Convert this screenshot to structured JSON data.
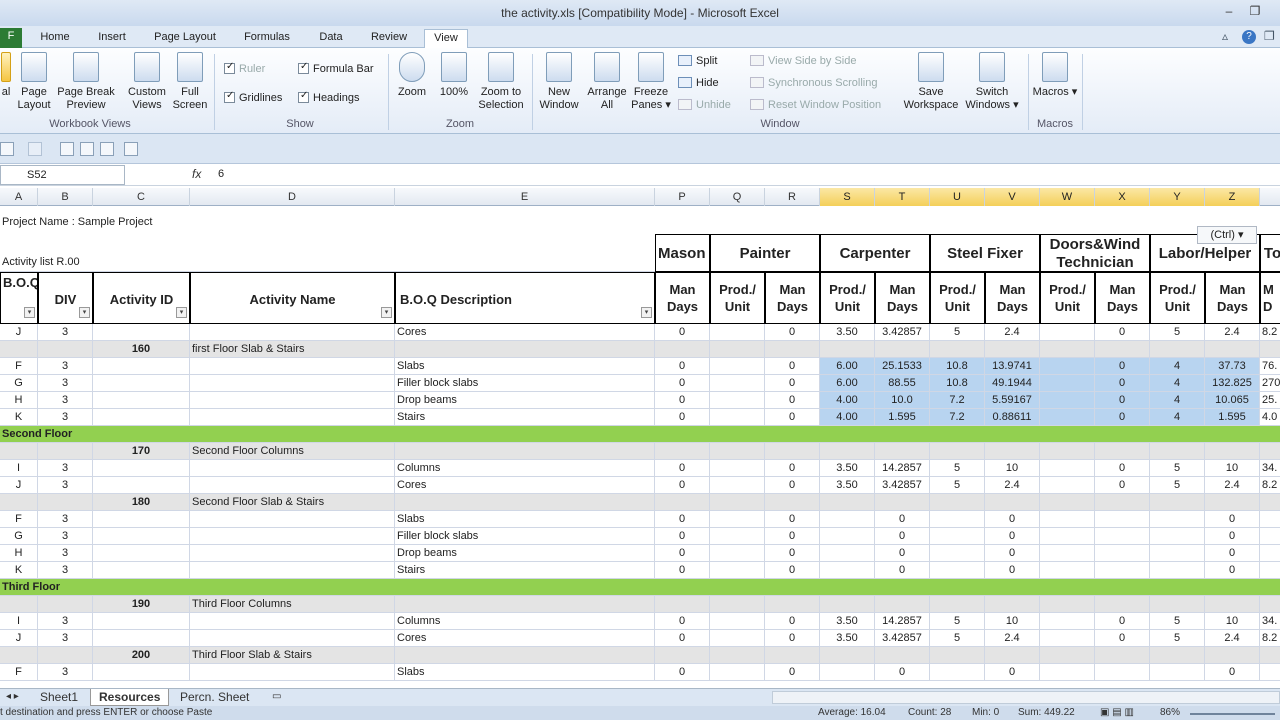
{
  "window": {
    "title": "the activity.xls  [Compatibility Mode]  -  Microsoft Excel",
    "minimize": "–",
    "maximize": "❐"
  },
  "ribbon_tabs": [
    "Home",
    "Insert",
    "Page Layout",
    "Formulas",
    "Data",
    "Review",
    "View"
  ],
  "file_tab": "F",
  "ribbon_right": {
    "minimize_ribbon": "▵",
    "help": "?",
    "restore": "❐"
  },
  "ribbon": {
    "workbook_views": {
      "label": "Workbook Views",
      "normal": "al",
      "page_layout": "Page Layout",
      "page_break": "Page Break Preview",
      "custom_views": "Custom Views",
      "full_screen": "Full Screen"
    },
    "show": {
      "label": "Show",
      "ruler": "Ruler",
      "formula_bar": "Formula Bar",
      "gridlines": "Gridlines",
      "headings": "Headings"
    },
    "zoom": {
      "label": "Zoom",
      "zoom": "Zoom",
      "hundred": "100%",
      "zoom_selection": "Zoom to Selection"
    },
    "window": {
      "label": "Window",
      "new_window": "New Window",
      "arrange_all": "Arrange All",
      "freeze_panes": "Freeze Panes ▾",
      "split": "Split",
      "hide": "Hide",
      "unhide": "Unhide",
      "side_by_side": "View Side by Side",
      "sync_scroll": "Synchronous Scrolling",
      "reset_position": "Reset Window Position",
      "save_workspace": "Save Workspace",
      "switch_windows": "Switch Windows ▾"
    },
    "macros": {
      "label": "Macros",
      "macros": "Macros ▾"
    }
  },
  "formula_bar": {
    "name_box": "S52",
    "fx": "fx",
    "value": "6"
  },
  "columns": [
    {
      "l": "A",
      "w": 38
    },
    {
      "l": "B",
      "w": 55
    },
    {
      "l": "C",
      "w": 97
    },
    {
      "l": "D",
      "w": 205
    },
    {
      "l": "E",
      "w": 260
    },
    {
      "l": "P",
      "w": 55
    },
    {
      "l": "Q",
      "w": 55
    },
    {
      "l": "R",
      "w": 55
    },
    {
      "l": "S",
      "w": 55,
      "sel": true
    },
    {
      "l": "T",
      "w": 55,
      "sel": true
    },
    {
      "l": "U",
      "w": 55,
      "sel": true
    },
    {
      "l": "V",
      "w": 55,
      "sel": true
    },
    {
      "l": "W",
      "w": 55,
      "sel": true
    },
    {
      "l": "X",
      "w": 55,
      "sel": true
    },
    {
      "l": "Y",
      "w": 55,
      "sel": true
    },
    {
      "l": "Z",
      "w": 55,
      "sel": true
    },
    {
      "l": "",
      "w": 25
    }
  ],
  "sheet_header": {
    "project_name": "Project Name : Sample Project",
    "activity_list": "Activity list R.00",
    "boq_ref": "B.O.Q Re",
    "div": "DIV",
    "activity_id": "Activity ID",
    "activity_name": "Activity Name",
    "boq_description": "B.O.Q Description",
    "trades": [
      "Mason",
      "Painter",
      "Carpenter",
      "Steel Fixer",
      "Doors&Wind Technician",
      "Labor/Helper",
      "To"
    ],
    "sub_mason": "Man Days",
    "sub_pair": [
      "Prod./ Unit",
      "Man Days"
    ],
    "sub_last": "M D"
  },
  "rows": [
    {
      "t": "item",
      "ref": "J",
      "div": "3",
      "desc": "Cores",
      "p": "0",
      "r": "0",
      "s": "3.50",
      "tv": "3.42857",
      "u": "5",
      "v": "2.4",
      "x": "0",
      "y": "5",
      "z": "2.4",
      "aa": "8.2"
    },
    {
      "t": "group",
      "id": "160",
      "name": "first Floor Slab & Stairs"
    },
    {
      "t": "item",
      "sel": true,
      "ref": "F",
      "div": "3",
      "desc": "Slabs",
      "p": "0",
      "r": "0",
      "s": "6.00",
      "tv": "25.1533",
      "u": "10.8",
      "v": "13.9741",
      "x": "0",
      "y": "4",
      "z": "37.73",
      "aa": "76."
    },
    {
      "t": "item",
      "sel": true,
      "ref": "G",
      "div": "3",
      "desc": "Filler block slabs",
      "p": "0",
      "r": "0",
      "s": "6.00",
      "tv": "88.55",
      "u": "10.8",
      "v": "49.1944",
      "x": "0",
      "y": "4",
      "z": "132.825",
      "aa": "270"
    },
    {
      "t": "item",
      "sel": true,
      "ref": "H",
      "div": "3",
      "desc": "Drop beams",
      "p": "0",
      "r": "0",
      "s": "4.00",
      "tv": "10.0",
      "u": "7.2",
      "v": "5.59167",
      "x": "0",
      "y": "4",
      "z": "10.065",
      "aa": "25."
    },
    {
      "t": "item",
      "sel": true,
      "ref": "K",
      "div": "3",
      "desc": "Stairs",
      "p": "0",
      "r": "0",
      "s": "4.00",
      "tv": "1.595",
      "u": "7.2",
      "v": "0.88611",
      "x": "0",
      "y": "4",
      "z": "1.595",
      "aa": "4.0"
    },
    {
      "t": "floor",
      "name": "Second Floor"
    },
    {
      "t": "group",
      "id": "170",
      "name": "Second Floor Columns"
    },
    {
      "t": "item",
      "ref": "I",
      "div": "3",
      "desc": "Columns",
      "p": "0",
      "r": "0",
      "s": "3.50",
      "tv": "14.2857",
      "u": "5",
      "v": "10",
      "x": "0",
      "y": "5",
      "z": "10",
      "aa": "34."
    },
    {
      "t": "item",
      "ref": "J",
      "div": "3",
      "desc": "Cores",
      "p": "0",
      "r": "0",
      "s": "3.50",
      "tv": "3.42857",
      "u": "5",
      "v": "2.4",
      "x": "0",
      "y": "5",
      "z": "2.4",
      "aa": "8.2"
    },
    {
      "t": "group",
      "id": "180",
      "name": "Second Floor Slab & Stairs"
    },
    {
      "t": "item",
      "ref": "F",
      "div": "3",
      "desc": "Slabs",
      "p": "0",
      "r": "0",
      "s": "",
      "tv": "0",
      "u": "",
      "v": "0",
      "x": "",
      "y": "",
      "z": "0",
      "aa": ""
    },
    {
      "t": "item",
      "ref": "G",
      "div": "3",
      "desc": "Filler block slabs",
      "p": "0",
      "r": "0",
      "s": "",
      "tv": "0",
      "u": "",
      "v": "0",
      "x": "",
      "y": "",
      "z": "0",
      "aa": ""
    },
    {
      "t": "item",
      "ref": "H",
      "div": "3",
      "desc": "Drop beams",
      "p": "0",
      "r": "0",
      "s": "",
      "tv": "0",
      "u": "",
      "v": "0",
      "x": "",
      "y": "",
      "z": "0",
      "aa": ""
    },
    {
      "t": "item",
      "ref": "K",
      "div": "3",
      "desc": "Stairs",
      "p": "0",
      "r": "0",
      "s": "",
      "tv": "0",
      "u": "",
      "v": "0",
      "x": "",
      "y": "",
      "z": "0",
      "aa": ""
    },
    {
      "t": "floor",
      "name": "Third Floor"
    },
    {
      "t": "group",
      "id": "190",
      "name": "Third Floor Columns"
    },
    {
      "t": "item",
      "ref": "I",
      "div": "3",
      "desc": "Columns",
      "p": "0",
      "r": "0",
      "s": "3.50",
      "tv": "14.2857",
      "u": "5",
      "v": "10",
      "x": "0",
      "y": "5",
      "z": "10",
      "aa": "34."
    },
    {
      "t": "item",
      "ref": "J",
      "div": "3",
      "desc": "Cores",
      "p": "0",
      "r": "0",
      "s": "3.50",
      "tv": "3.42857",
      "u": "5",
      "v": "2.4",
      "x": "0",
      "y": "5",
      "z": "2.4",
      "aa": "8.2"
    },
    {
      "t": "group",
      "id": "200",
      "name": "Third Floor Slab & Stairs"
    },
    {
      "t": "item",
      "ref": "F",
      "div": "3",
      "desc": "Slabs",
      "p": "0",
      "r": "0",
      "s": "",
      "tv": "0",
      "u": "",
      "v": "0",
      "x": "",
      "y": "",
      "z": "0",
      "aa": ""
    }
  ],
  "paste_options": "(Ctrl) ▾",
  "sheet_tabs": [
    "Sheet1",
    "Resources",
    "Percn. Sheet"
  ],
  "active_sheet": "Resources",
  "status": {
    "message": "t destination and press ENTER or choose Paste",
    "average": "Average: 16.04",
    "count": "Count: 28",
    "min": "Min: 0",
    "sum": "Sum: 449.22",
    "zoom": "86%"
  },
  "colors": {
    "selection": "#b8d4f0",
    "floor_band": "#92d050",
    "group_band": "#e4e4e4",
    "file_tab": "#2c7b34"
  }
}
